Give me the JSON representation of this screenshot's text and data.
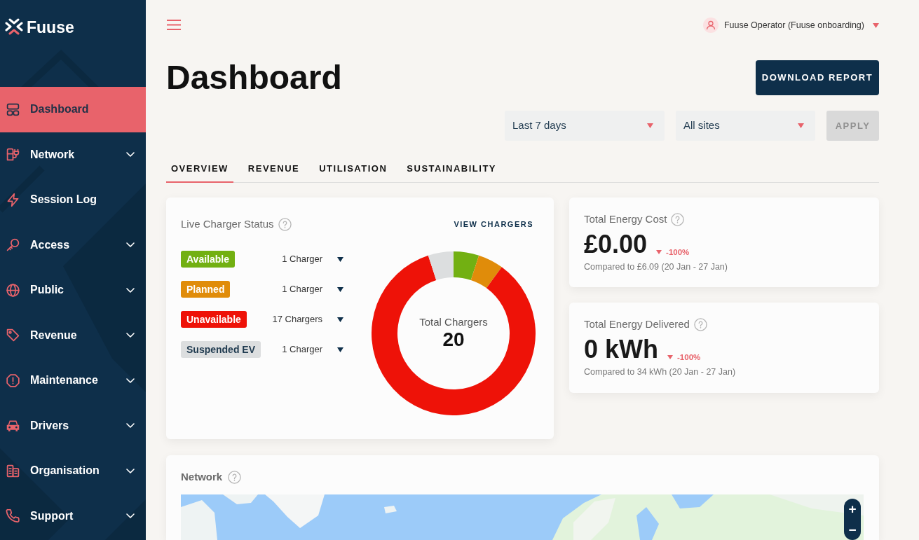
{
  "sidebar": {
    "brand": "Fuuse",
    "items": [
      {
        "label": "Dashboard",
        "selected": true,
        "has_submenu": false
      },
      {
        "label": "Network",
        "selected": false,
        "has_submenu": true
      },
      {
        "label": "Session Log",
        "selected": false,
        "has_submenu": false
      },
      {
        "label": "Access",
        "selected": false,
        "has_submenu": true
      },
      {
        "label": "Public",
        "selected": false,
        "has_submenu": true
      },
      {
        "label": "Revenue",
        "selected": false,
        "has_submenu": true
      },
      {
        "label": "Maintenance",
        "selected": false,
        "has_submenu": true
      },
      {
        "label": "Drivers",
        "selected": false,
        "has_submenu": true
      },
      {
        "label": "Organisation",
        "selected": false,
        "has_submenu": true
      },
      {
        "label": "Support",
        "selected": false,
        "has_submenu": true
      }
    ]
  },
  "header": {
    "user": "Fuuse Operator (Fuuse onboarding)"
  },
  "page": {
    "title": "Dashboard",
    "download_button": "DOWNLOAD REPORT"
  },
  "filters": {
    "selects": [
      {
        "value": "Last 7 days"
      },
      {
        "value": "All sites"
      }
    ],
    "apply": {
      "label": "APPLY",
      "disabled": true
    }
  },
  "tabs": [
    {
      "label": "OVERVIEW",
      "selected": true
    },
    {
      "label": "REVENUE",
      "selected": false
    },
    {
      "label": "UTILISATION",
      "selected": false
    },
    {
      "label": "SUSTAINABILITY",
      "selected": false
    }
  ],
  "charger_status": {
    "title": "Live Charger Status",
    "link": "VIEW CHARGERS",
    "statuses": [
      {
        "color": "#72b012",
        "count": "1 Charger"
      },
      {
        "color": "#e08c0a",
        "count": "1 Charger"
      },
      {
        "color": "#ee1208",
        "count": "17 Chargers"
      },
      {
        "color": "#dcdedf",
        "count": "1 Charger"
      }
    ],
    "chart_data": {
      "type": "donut",
      "categories": [
        "Available",
        "Planned",
        "Unavailable",
        "Suspended EV"
      ],
      "values": [
        5,
        5,
        85,
        5
      ]
    },
    "center_label": "Total Chargers",
    "center_value": "20"
  },
  "metrics": [
    {
      "title": "Total Energy Cost",
      "value": "£0.00",
      "decrease": true,
      "change": "-100%",
      "comparison": "Compared to £6.09 (20 Jan - 27 Jan)"
    },
    {
      "title": "Total Energy Delivered",
      "value": "0 kWh",
      "decrease": true,
      "change": "-100%",
      "comparison": "Compared to 34 kWh (20 Jan - 27 Jan)"
    }
  ],
  "network": {
    "title": "Network",
    "zoom_buttons": [
      "+",
      "−"
    ]
  }
}
